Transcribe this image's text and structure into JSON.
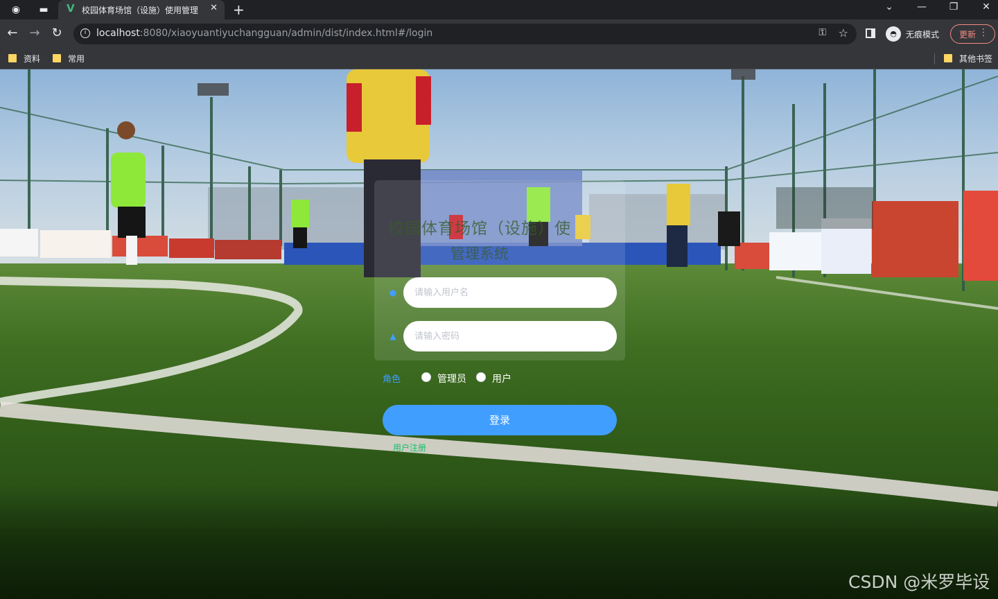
{
  "browser": {
    "tab_title": "校园体育场馆（设施）使用管理",
    "tab_favicon": "vue-logo-icon",
    "url_host": "localhost",
    "url_rest": ":8080/xiaoyuantiyuchangguan/admin/dist/index.html#/login",
    "incognito_label": "无痕模式",
    "update_label": "更新",
    "bookmarks": [
      {
        "label": "资料"
      },
      {
        "label": "常用"
      }
    ],
    "other_bookmarks": "其他书签"
  },
  "page": {
    "system_title": "校园体育场馆（设施）使",
    "system_subtitle": "管理系统",
    "username_placeholder": "请输入用户名",
    "password_placeholder": "请输入密码",
    "role_label": "角色",
    "roles": [
      {
        "label": "管理员"
      },
      {
        "label": "用户"
      }
    ],
    "login_button": "登录",
    "register_link": "用户注册"
  },
  "watermark": "CSDN @米罗毕设",
  "colors": {
    "primary": "#409eff",
    "register": "#19be6b",
    "chrome_dark": "#202124",
    "chrome_toolbar": "#35363a"
  }
}
